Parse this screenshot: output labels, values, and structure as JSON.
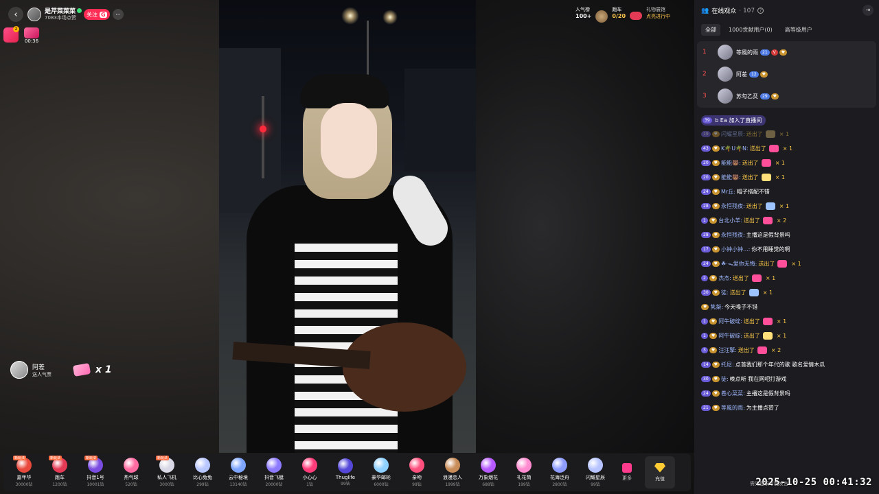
{
  "host": {
    "name": "是芹菜菜菜",
    "sub": "7083本场点赞",
    "follow_label": "关注",
    "fan_badge": "G",
    "more": "···"
  },
  "redpack": {
    "badge": "2"
  },
  "gift_timer": {
    "time": "00:36"
  },
  "top_stats": {
    "popularity_label": "人气榜",
    "popularity_value": "100+",
    "race_label": "跑车",
    "race_value": "0/20",
    "gift_label": "礼物展馆",
    "gift_sub": "点亮进行中"
  },
  "gift_notice": {
    "name": "阿差",
    "sub": "送人气票",
    "count": "x 1"
  },
  "giftbar": {
    "items": [
      {
        "name": "嘉年华",
        "price": "30000钻",
        "tag": "新玩法",
        "color": "#e8493c"
      },
      {
        "name": "跑车",
        "price": "1200钻",
        "tag": "新玩法",
        "color": "#e43a55"
      },
      {
        "name": "抖音1号",
        "price": "10001钻",
        "tag": "新玩法",
        "color": "#7a4ce0"
      },
      {
        "name": "热气球",
        "price": "520钻",
        "tag": "",
        "color": "#ff6aa0"
      },
      {
        "name": "私人飞机",
        "price": "3000钻",
        "tag": "新玩法",
        "color": "#d8d8e6"
      },
      {
        "name": "比心兔兔",
        "price": "299钻",
        "tag": "",
        "color": "#b9c7ff"
      },
      {
        "name": "云中秘境",
        "price": "13140钻",
        "tag": "",
        "color": "#7fa6ff"
      },
      {
        "name": "抖音飞艇",
        "price": "20000钻",
        "tag": "",
        "color": "#8d7bff"
      },
      {
        "name": "小心心",
        "price": "1钻",
        "tag": "",
        "color": "#ff3b7a"
      },
      {
        "name": "Thuglife",
        "price": "99钻",
        "tag": "",
        "color": "#5548d8"
      },
      {
        "name": "豪华邮轮",
        "price": "6000钻",
        "tag": "",
        "color": "#8ed0ff"
      },
      {
        "name": "亲吻",
        "price": "99钻",
        "tag": "",
        "color": "#ff4f7d"
      },
      {
        "name": "浪漫恋人",
        "price": "1999钻",
        "tag": "",
        "color": "#c98d5a"
      },
      {
        "name": "万象烟花",
        "price": "688钻",
        "tag": "",
        "color": "#b659ff"
      },
      {
        "name": "礼花筒",
        "price": "199钻",
        "tag": "",
        "color": "#ff8bd0"
      },
      {
        "name": "花海泛舟",
        "price": "2800钻",
        "tag": "",
        "color": "#8e9cff"
      },
      {
        "name": "闪耀星辰",
        "price": "99钻",
        "tag": "",
        "color": "#b7c4ff"
      }
    ],
    "more_label": "更多",
    "recharge_label": "充值"
  },
  "panel": {
    "title": "在线观众",
    "count": "· 107",
    "tabs": [
      "全部",
      "1000贡献用户(0)",
      "高等级用户"
    ],
    "ranks": [
      {
        "rank": "1",
        "name": "等風的雨",
        "level": "21",
        "badges": [
          "V"
        ]
      },
      {
        "rank": "2",
        "name": "阿差",
        "level": "12",
        "badges": []
      },
      {
        "rank": "3",
        "name": "苏勾乙烎",
        "level": "29",
        "badges": []
      }
    ]
  },
  "chat": {
    "join": {
      "level": "39",
      "who": "b Ea",
      "action": "加入了直播间"
    },
    "messages": [
      {
        "level": "19",
        "user": "闪耀星辰:",
        "sent": "送出了",
        "qty": "× 1",
        "gift_color": "#d2b46e",
        "faded": true
      },
      {
        "level": "43",
        "user": "K🌴U🌴N:",
        "sent": "送出了",
        "qty": "× 1",
        "gift_color": "#ff4f9a"
      },
      {
        "level": "20",
        "user": "能能🐻:",
        "sent": "送出了",
        "qty": "× 1",
        "gift_color": "#ff4f9a"
      },
      {
        "level": "20",
        "user": "能能🐻:",
        "sent": "送出了",
        "qty": "× 1",
        "gift_color": "#ffe07a"
      },
      {
        "level": "24",
        "user": "Mr丘:",
        "text": "帽子搭配不错"
      },
      {
        "level": "28",
        "user": "永恒残夜:",
        "sent": "送出了",
        "qty": "× 1",
        "gift_color": "#9ec4ff"
      },
      {
        "level": "1",
        "user": "台北小羊:",
        "sent": "送出了",
        "qty": "× 2",
        "gift_color": "#ff4f9a"
      },
      {
        "level": "28",
        "user": "永恒残夜:",
        "text": "主播这是假背景吗"
      },
      {
        "level": "17",
        "user": "小钟小钟...:",
        "text": "你不用睡觉的啊"
      },
      {
        "level": "24",
        "user": "☘·ᯓ爱你无悔:",
        "sent": "送出了",
        "qty": "× 1",
        "gift_color": "#ff4f9a"
      },
      {
        "level": "2",
        "user": "杰杰:",
        "sent": "送出了",
        "qty": "× 1",
        "gift_color": "#ff4f9a"
      },
      {
        "level": "30",
        "user": "徒:",
        "sent": "送出了",
        "qty": "× 1",
        "gift_color": "#9ec4ff"
      },
      {
        "level": "",
        "user": "隽桀:",
        "text": "今天嗓子不错"
      },
      {
        "level": "1",
        "user": "阿牛破绽:",
        "sent": "送出了",
        "qty": "× 1",
        "gift_color": "#ff4f9a"
      },
      {
        "level": "1",
        "user": "阿牛破绽:",
        "sent": "送出了",
        "qty": "× 1",
        "gift_color": "#ffe07a"
      },
      {
        "level": "3",
        "user": "汪汪擎:",
        "sent": "送出了",
        "qty": "× 2",
        "gift_color": "#ff4f9a"
      },
      {
        "level": "14",
        "user": "托尼:",
        "text": "点首我们那个年代的歌 歌名爱情木瓜"
      },
      {
        "level": "30",
        "user": "徒:",
        "text": "晚点听 我在网吧打游戏"
      },
      {
        "level": "24",
        "user": "卷心菜菜:",
        "text": "主播这是假背景吗"
      },
      {
        "level": "21",
        "user": "等風的雨:",
        "text": "为主播点赞了"
      }
    ]
  },
  "bottom_prompt": "需先登录才能发言",
  "timestamp": "2025-10-25 00:41:32",
  "colors": {
    "accent": "#fe2c55",
    "gold": "#ffcb47",
    "panel_bg": "#1c1c20"
  }
}
